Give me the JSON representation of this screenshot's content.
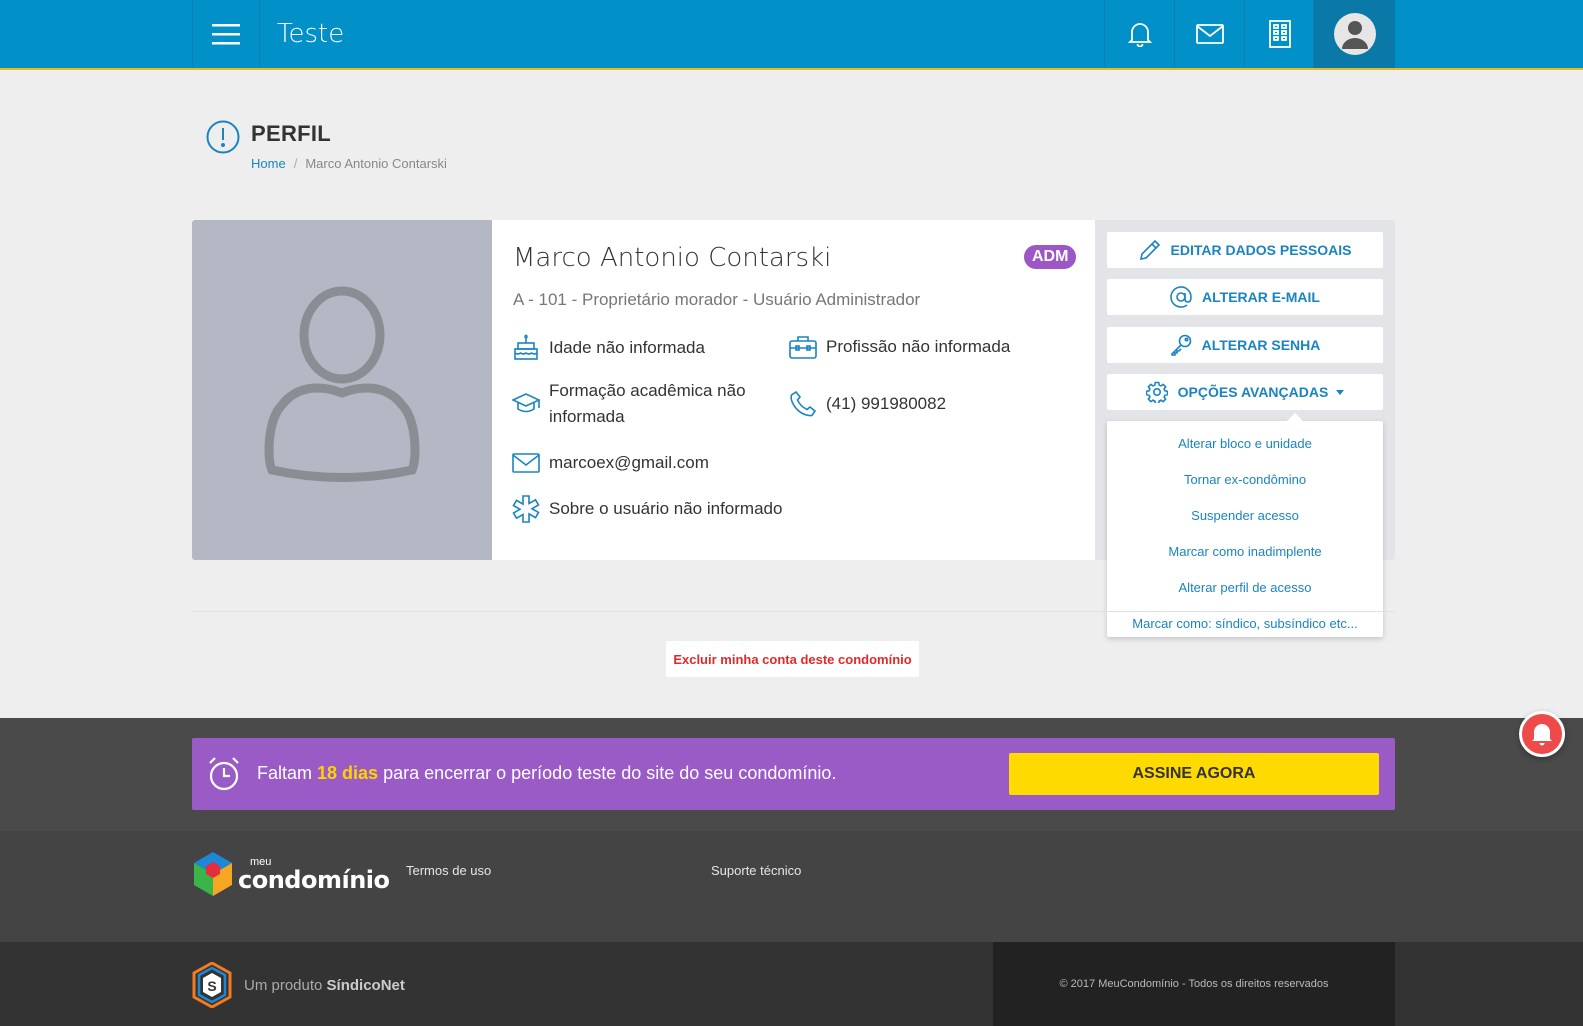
{
  "header": {
    "app_title": "Teste",
    "menu_icon": "hamburger-icon",
    "icons": [
      "bell-icon",
      "mail-icon",
      "building-icon",
      "user-avatar-icon"
    ]
  },
  "page": {
    "title": "PERFIL",
    "breadcrumb": {
      "home": "Home",
      "separator": "/",
      "current": "Marco Antonio Contarski"
    }
  },
  "profile": {
    "name": "Marco Antonio Contarski",
    "badge": "ADM",
    "subline": "A - 101 - Proprietário morador - Usuário Administrador",
    "age": "Idade não informada",
    "profession": "Profissão não informada",
    "education_line1": "Formação acadêmica não",
    "education_line2": "informada",
    "phone": "(41) 991980082",
    "email": "marcoex@gmail.com",
    "about": "Sobre o usuário não informado"
  },
  "actions": {
    "edit": "EDITAR DADOS PESSOAIS",
    "email": "ALTERAR E-MAIL",
    "password": "ALTERAR SENHA",
    "advanced": "OPÇÕES AVANÇADAS"
  },
  "advanced_menu": [
    "Alterar bloco e unidade",
    "Tornar ex-condômino",
    "Suspender acesso",
    "Marcar como inadimplente",
    "Alterar perfil de acesso",
    "Marcar como: síndico, subsíndico etc..."
  ],
  "delete_account": "Excluir minha conta deste condomínio",
  "trial": {
    "prefix": "Faltam",
    "days": "18 dias",
    "suffix": "para encerrar o período teste do site do seu condomínio.",
    "button": "ASSINE AGORA"
  },
  "footer": {
    "logo_meu": "meu",
    "logo_condominio": "condomínio",
    "terms": "Termos de uso",
    "support": "Suporte técnico",
    "product_prefix": "Um produto",
    "product_name": "SíndicoNet",
    "copyright": "© 2017 MeuCondomínio - Todos os direitos reservados"
  },
  "colors": {
    "topbar": "#0290c8",
    "accent": "#1a84c0",
    "badge": "#9c56c6",
    "trial": "#9b5bc7",
    "subscribe": "#ffda00",
    "danger": "#e02a2a"
  }
}
